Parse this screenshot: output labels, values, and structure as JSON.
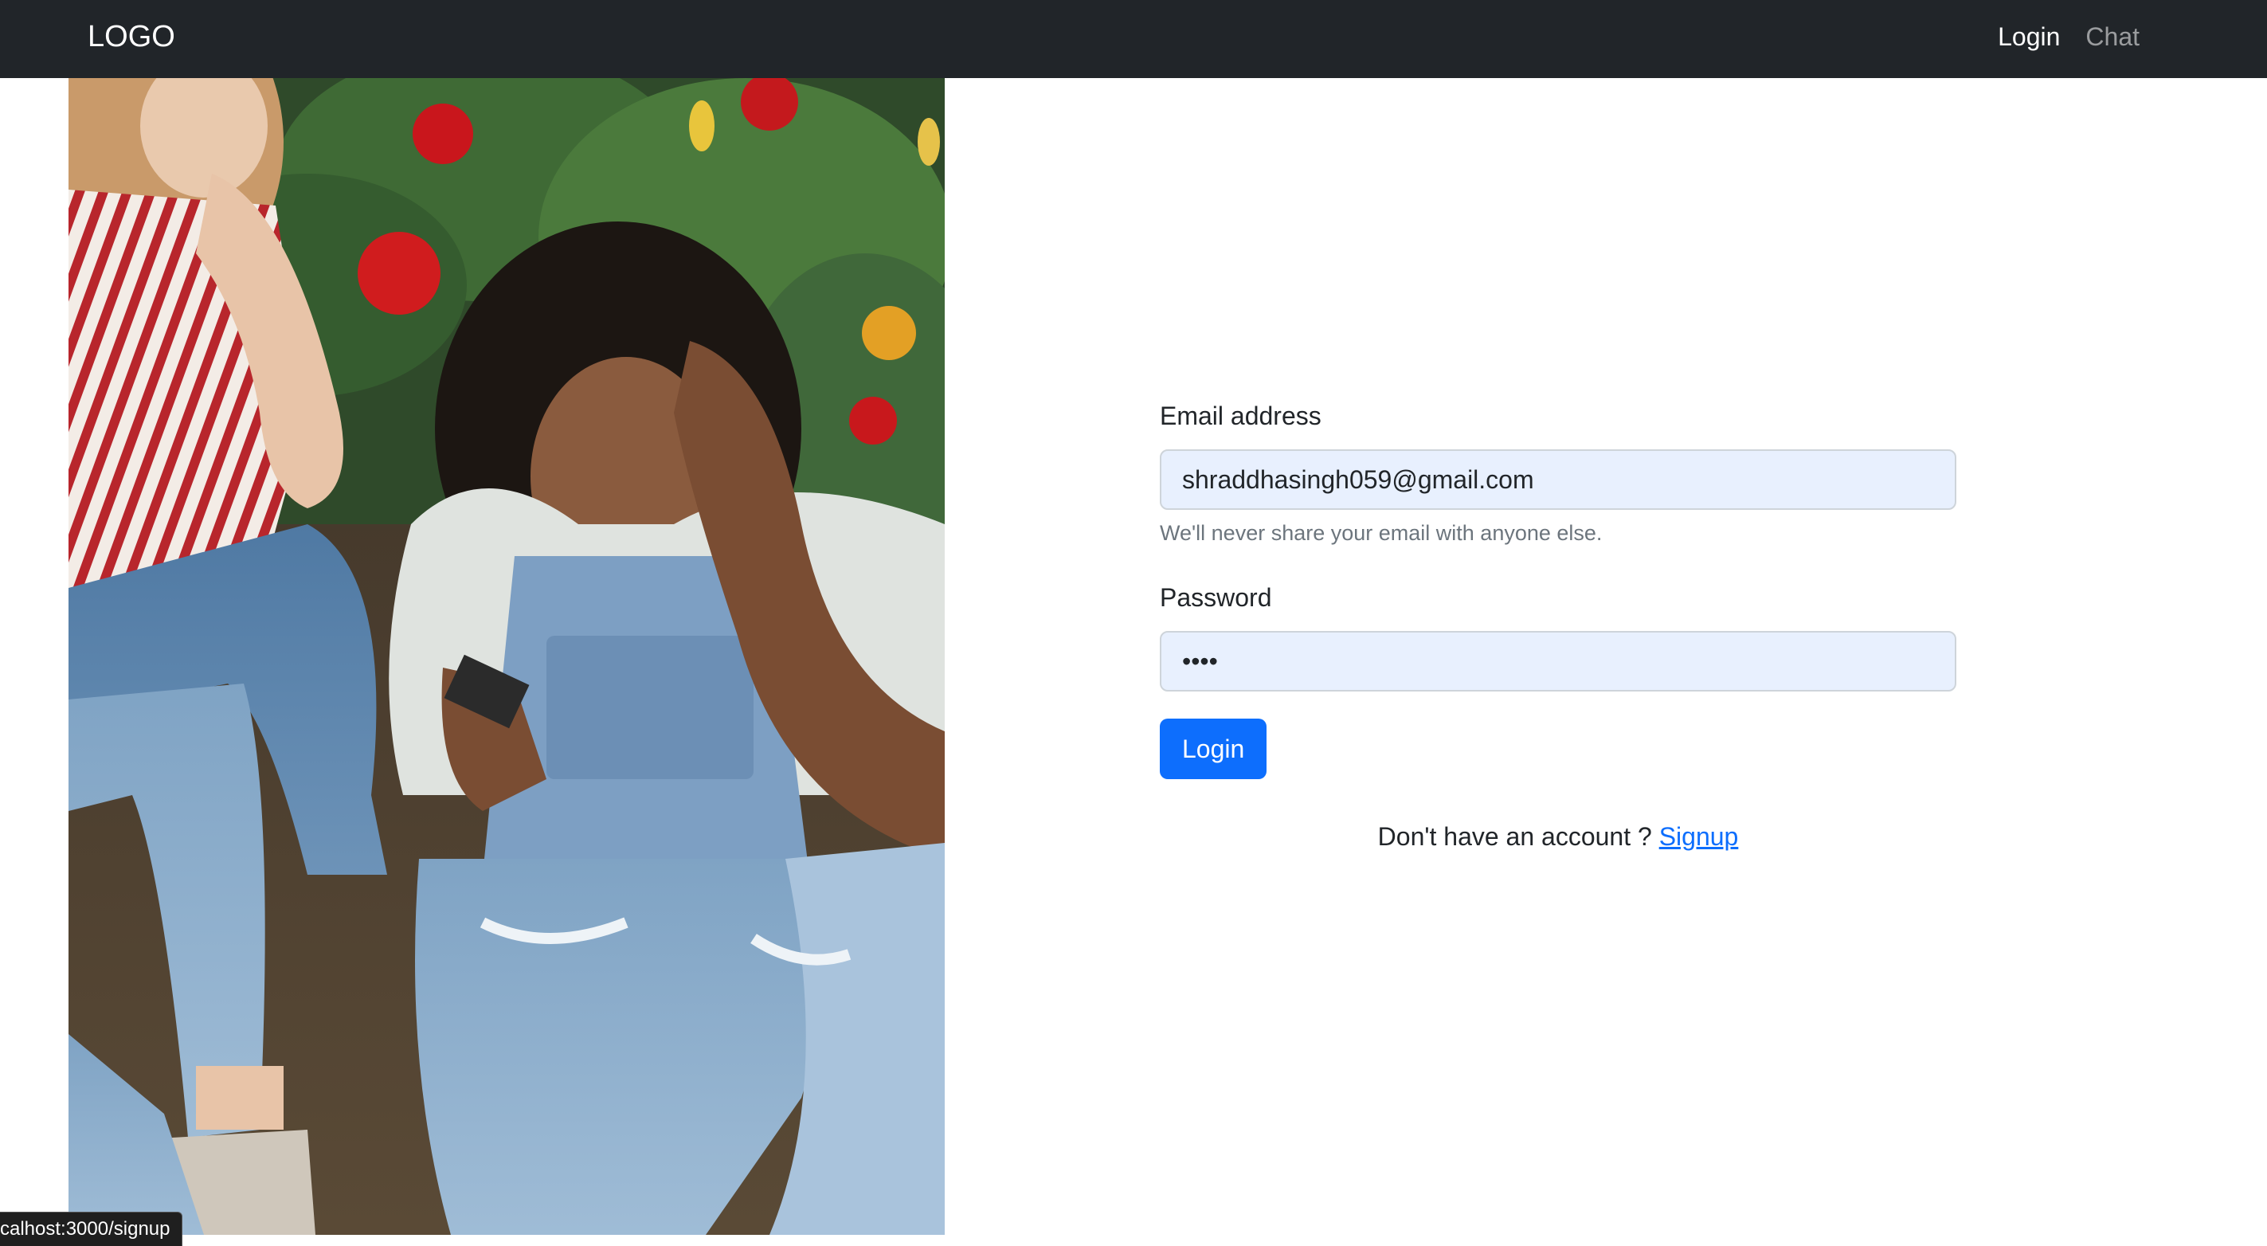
{
  "navbar": {
    "brand": "LOGO",
    "links": [
      {
        "label": "Login",
        "active": true
      },
      {
        "label": "Chat",
        "active": false
      }
    ],
    "background": "#212529"
  },
  "hero_image": {
    "description": "photo-of-two-women-sitting-among-flowers"
  },
  "form": {
    "email_label": "Email address",
    "email_value": "shraddhasingh059@gmail.com",
    "email_help": "We'll never share your email with anyone else.",
    "password_label": "Password",
    "password_value": "abcd",
    "submit_label": "Login",
    "signup_prompt": "Don't have an account ? ",
    "signup_link": "Signup"
  },
  "status_bar": {
    "url": "calhost:3000/signup"
  },
  "colors": {
    "primary": "#0d6efd",
    "autofill_bg": "#e8f0fe"
  }
}
